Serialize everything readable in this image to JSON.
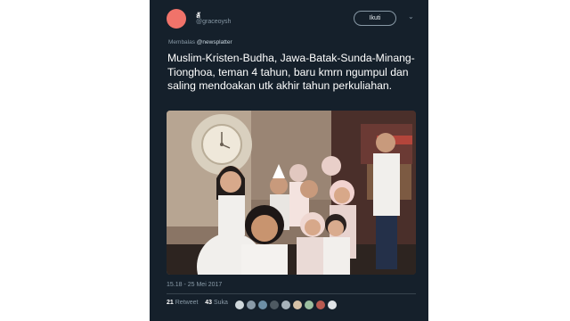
{
  "tweet": {
    "display_name": "ลั",
    "handle": "@graceoysh",
    "follow_label": "Ikuti",
    "reply_prefix": "Membalas",
    "reply_to": "@newsplatter",
    "text": "Muslim-Kristen-Budha, Jawa-Batak-Sunda-Minang-Tionghoa, teman 4 tahun, baru kmrn ngumpul dan saling mendoakan utk akhir tahun perkuliahan.",
    "timestamp": "15.18 - 25 Mei 2017",
    "retweet_count": "21",
    "retweet_label": "Retweet",
    "like_count": "43",
    "like_label": "Suka"
  },
  "icons": [
    "chevron-down-icon"
  ],
  "colors": {
    "card_bg": "#15202b",
    "avatar": "#f0736a",
    "text_secondary": "#8899a6"
  }
}
